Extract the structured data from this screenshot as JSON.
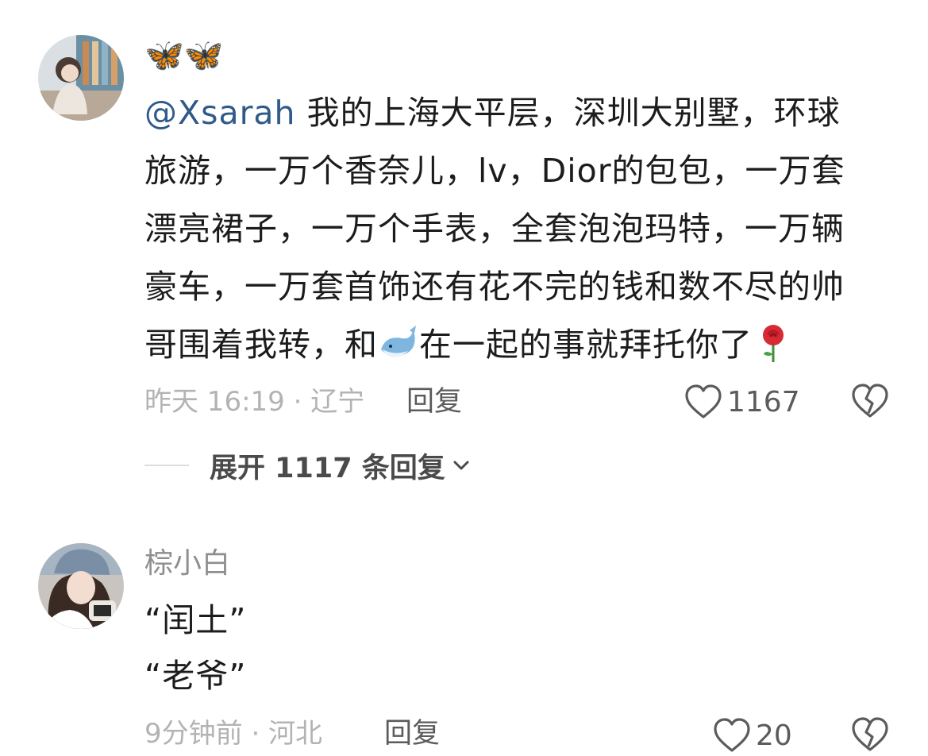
{
  "comments": [
    {
      "username": "🦋🦋",
      "mention": "@Xsarah",
      "text_lines": [
        "我的上海大平层，深圳大别墅，环球",
        "旅游，一万个香奈儿，lv，Dior的包包，一万套",
        "漂亮裙子，一万个手表，全套泡泡玛特，一万辆",
        "豪车，一万套首饰还有花不完的钱和数不尽的帅",
        "哥围着我转，和",
        "在一起的事就拜托你了"
      ],
      "meta": "昨天 16:19 · 辽宁",
      "reply_label": "回复",
      "like_count": "1167",
      "expand_label": "展开 1117 条回复"
    },
    {
      "username": "棕小白",
      "text_lines": [
        "“闰土”",
        "“老爷”"
      ],
      "meta": "9分钟前 · 河北",
      "reply_label": "回复",
      "like_count": "20"
    }
  ],
  "icons": {
    "like": "heart-outline-icon",
    "dislike": "broken-heart-icon",
    "expand": "chevron-down-icon",
    "emoji_whale": "whale-emoji",
    "emoji_rose": "rose-emoji"
  }
}
